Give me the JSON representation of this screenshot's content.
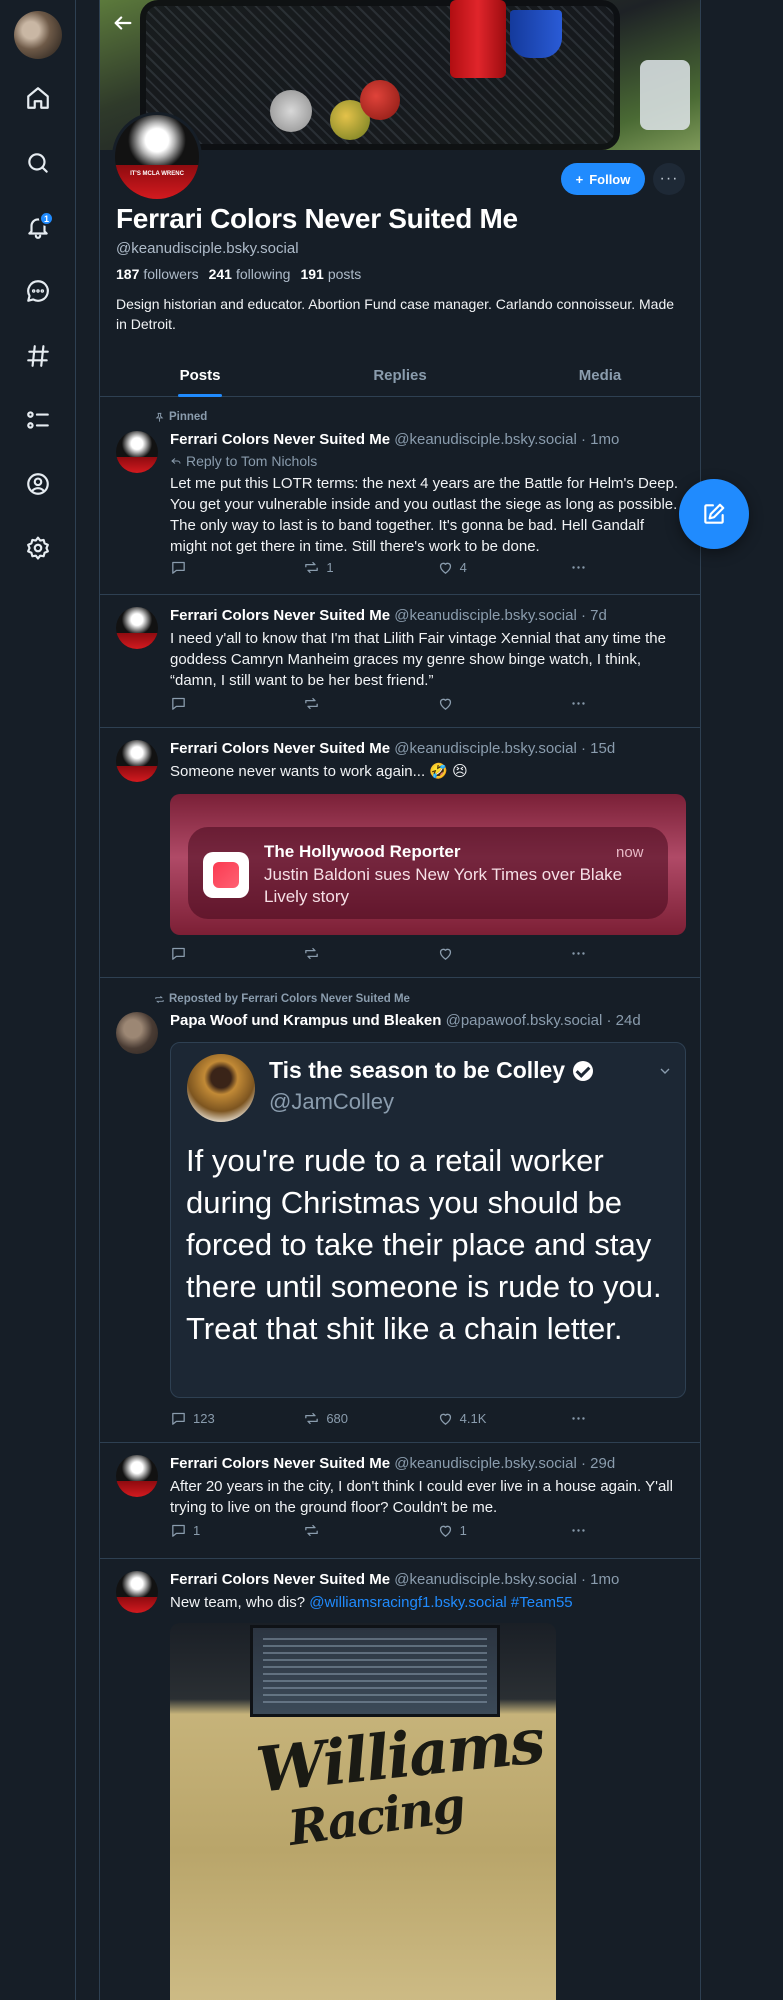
{
  "rail": {
    "notifications_badge": "1"
  },
  "profile": {
    "display_name": "Ferrari Colors Never Suited Me",
    "handle": "@keanudisciple.bsky.social",
    "avatar_caption": "IT'S MCLA WRENC",
    "followers_count": "187",
    "followers_label": "followers",
    "following_count": "241",
    "following_label": "following",
    "posts_count": "191",
    "posts_label": "posts",
    "bio": "Design historian and educator. Abortion Fund case manager. Carlando connoisseur. Made in Detroit.",
    "follow_label": "Follow",
    "more_label": "···"
  },
  "tabs": [
    "Posts",
    "Replies",
    "Media"
  ],
  "posts": [
    {
      "pinned_label": "Pinned",
      "author": "Ferrari Colors Never Suited Me",
      "handle": "@keanudisciple.bsky.social",
      "time": "· 1mo",
      "reply_to": "Reply to Tom Nichols",
      "text": "Let me put this LOTR terms: the next 4 years are the Battle for Helm's Deep. You get your vulnerable inside and you outlast the siege as long as possible. The only way to last is to band together. It's gonna be bad. Hell Gandalf might not get there in time. Still there's work to be done.",
      "replies": "",
      "reposts": "1",
      "likes": "4"
    },
    {
      "author": "Ferrari Colors Never Suited Me",
      "handle": "@keanudisciple.bsky.social",
      "time": "· 7d",
      "text": "I need y'all to know that I'm that Lilith Fair vintage Xennial that any time the goddess Camryn Manheim graces my genre show binge watch, I think, “damn, I still want to be her best friend.”",
      "replies": "",
      "reposts": "",
      "likes": ""
    },
    {
      "author": "Ferrari Colors Never Suited Me",
      "handle": "@keanudisciple.bsky.social",
      "time": "· 15d",
      "text": "Someone never wants to work again... 🤣 😣",
      "embed": {
        "source": "The Hollywood Reporter",
        "time": "now",
        "headline": "Justin Baldoni sues New York Times over Blake Lively story"
      },
      "replies": "",
      "reposts": "",
      "likes": ""
    },
    {
      "repost_label": "Reposted by Ferrari Colors Never Suited Me",
      "author": "Papa Woof und Krampus und Bleaken",
      "handle": "@papawoof.bsky.social",
      "time": "· 24d",
      "embed": {
        "name": "Tis the season to be Colley",
        "handle": "@JamColley",
        "text": "If you're rude to a retail worker during Christmas you should be forced to take their place and stay there until someone is rude to you. Treat that shit like a chain letter."
      },
      "replies": "123",
      "reposts": "680",
      "likes": "4.1K"
    },
    {
      "author": "Ferrari Colors Never Suited Me",
      "handle": "@keanudisciple.bsky.social",
      "time": "· 29d",
      "text": "After 20 years in the city, I don't think I could ever live in a house again. Y'all trying to live on the ground floor? Couldn't be me.",
      "replies": "1",
      "reposts": "",
      "likes": "1"
    },
    {
      "author": "Ferrari Colors Never Suited Me",
      "handle": "@keanudisciple.bsky.social",
      "time": "· 1mo",
      "text_plain": "New team, who dis?",
      "mention": "@williamsracingf1.bsky.social",
      "hashtag": "#Team55",
      "photo_text_1": "Williams",
      "photo_text_2": "Racing"
    }
  ],
  "colors": {
    "background": "#161e27",
    "accent": "#208bfe",
    "border": "#2e4052",
    "muted_text": "#8a9cad"
  }
}
